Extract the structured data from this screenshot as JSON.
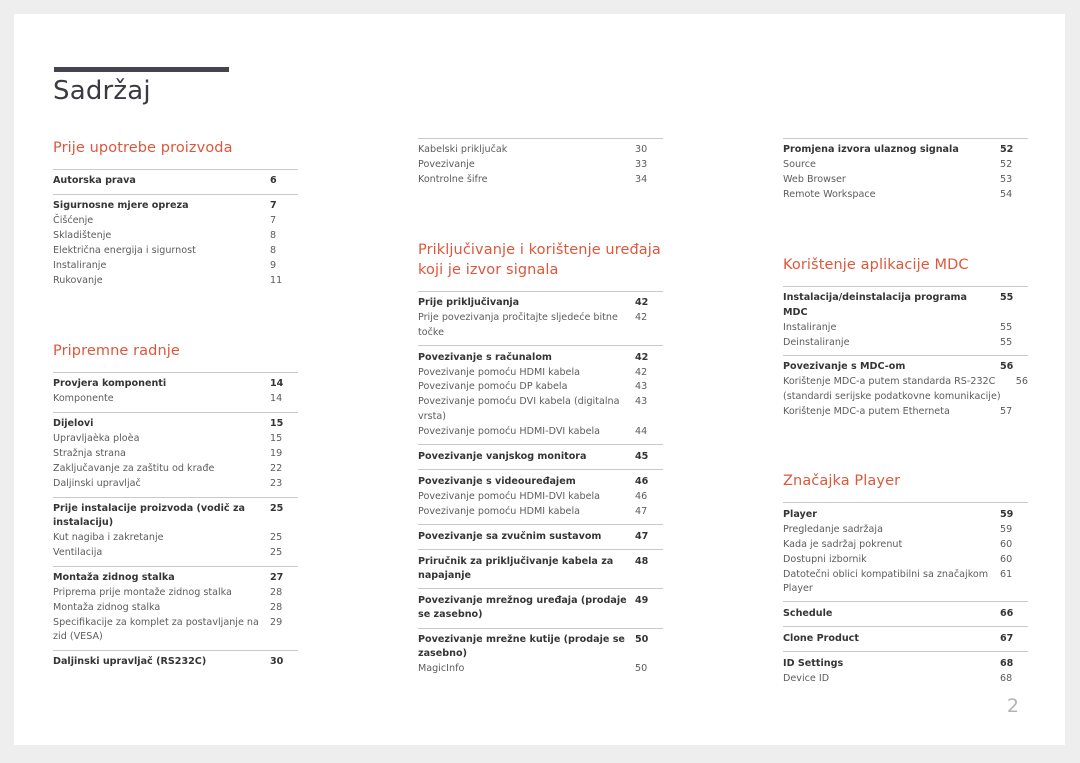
{
  "document": {
    "title": "Sadržaj",
    "folio": "2",
    "accent_color": "#dd573c",
    "rule_color": "#45434e"
  },
  "columns": [
    {
      "id": "column-1",
      "sections": [
        {
          "heading": "Prije upotrebe proizvoda",
          "groups": [
            {
              "entries": [
                {
                  "label": "Autorska prava",
                  "page": "6",
                  "bold": true
                }
              ]
            },
            {
              "entries": [
                {
                  "label": "Sigurnosne mjere opreza",
                  "page": "7",
                  "bold": true
                },
                {
                  "label": "Čišćenje",
                  "page": "7",
                  "bold": false
                },
                {
                  "label": "Skladištenje",
                  "page": "8",
                  "bold": false
                },
                {
                  "label": "Električna energija i sigurnost",
                  "page": "8",
                  "bold": false
                },
                {
                  "label": "Instaliranje",
                  "page": "9",
                  "bold": false
                },
                {
                  "label": "Rukovanje",
                  "page": "11",
                  "bold": false
                }
              ]
            }
          ]
        },
        {
          "heading": "Pripremne radnje",
          "groups": [
            {
              "entries": [
                {
                  "label": "Provjera komponenti",
                  "page": "14",
                  "bold": true
                },
                {
                  "label": "Komponente",
                  "page": "14",
                  "bold": false
                }
              ]
            },
            {
              "entries": [
                {
                  "label": "Dijelovi",
                  "page": "15",
                  "bold": true
                },
                {
                  "label": "Upravljaèka ploèa",
                  "page": "15",
                  "bold": false
                },
                {
                  "label": "Stražnja strana",
                  "page": "19",
                  "bold": false
                },
                {
                  "label": "Zaključavanje za zaštitu od krađe",
                  "page": "22",
                  "bold": false
                },
                {
                  "label": "Daljinski upravljač",
                  "page": "23",
                  "bold": false
                }
              ]
            },
            {
              "entries": [
                {
                  "label": "Prije instalacije proizvoda (vodič za instalaciju)",
                  "page": "25",
                  "bold": true
                },
                {
                  "label": "Kut nagiba i zakretanje",
                  "page": "25",
                  "bold": false
                },
                {
                  "label": "Ventilacija",
                  "page": "25",
                  "bold": false
                }
              ]
            },
            {
              "entries": [
                {
                  "label": "Montaža zidnog stalka",
                  "page": "27",
                  "bold": true
                },
                {
                  "label": "Priprema prije montaže zidnog stalka",
                  "page": "28",
                  "bold": false
                },
                {
                  "label": "Montaža zidnog stalka",
                  "page": "28",
                  "bold": false
                },
                {
                  "label": "Specifikacije za komplet za postavljanje na zid (VESA)",
                  "page": "29",
                  "bold": false
                }
              ]
            },
            {
              "entries": [
                {
                  "label": "Daljinski upravljač (RS232C)",
                  "page": "30",
                  "bold": true
                }
              ]
            }
          ]
        }
      ]
    },
    {
      "id": "column-2",
      "sections": [
        {
          "heading": null,
          "groups": [
            {
              "entries": [
                {
                  "label": "Kabelski priključak",
                  "page": "30",
                  "bold": false
                },
                {
                  "label": "Povezivanje",
                  "page": "33",
                  "bold": false
                },
                {
                  "label": "Kontrolne šifre",
                  "page": "34",
                  "bold": false
                }
              ]
            }
          ]
        },
        {
          "heading": "Priključivanje i korištenje uređaja koji je izvor signala",
          "groups": [
            {
              "entries": [
                {
                  "label": "Prije priključivanja",
                  "page": "42",
                  "bold": true
                },
                {
                  "label": "Prije povezivanja pročitajte sljedeće bitne točke",
                  "page": "42",
                  "bold": false
                }
              ]
            },
            {
              "entries": [
                {
                  "label": "Povezivanje s računalom",
                  "page": "42",
                  "bold": true
                },
                {
                  "label": "Povezivanje pomoću HDMI kabela",
                  "page": "42",
                  "bold": false
                },
                {
                  "label": "Povezivanje pomoću DP kabela",
                  "page": "43",
                  "bold": false
                },
                {
                  "label": "Povezivanje pomoću DVI kabela (digitalna vrsta)",
                  "page": "43",
                  "bold": false
                },
                {
                  "label": "Povezivanje pomoću HDMI-DVI kabela",
                  "page": "44",
                  "bold": false
                }
              ]
            },
            {
              "entries": [
                {
                  "label": "Povezivanje vanjskog monitora",
                  "page": "45",
                  "bold": true
                }
              ]
            },
            {
              "entries": [
                {
                  "label": "Povezivanje s videouređajem",
                  "page": "46",
                  "bold": true
                },
                {
                  "label": "Povezivanje pomoću HDMI-DVI kabela",
                  "page": "46",
                  "bold": false
                },
                {
                  "label": "Povezivanje pomoću HDMI kabela",
                  "page": "47",
                  "bold": false
                }
              ]
            },
            {
              "entries": [
                {
                  "label": "Povezivanje sa zvučnim sustavom",
                  "page": "47",
                  "bold": true
                }
              ]
            },
            {
              "entries": [
                {
                  "label": "Priručnik za priključivanje kabela za napajanje",
                  "page": "48",
                  "bold": true
                }
              ]
            },
            {
              "entries": [
                {
                  "label": "Povezivanje mrežnog uređaja (prodaje se zasebno)",
                  "page": "49",
                  "bold": true
                }
              ]
            },
            {
              "entries": [
                {
                  "label": "Povezivanje mrežne kutije (prodaje se zasebno)",
                  "page": "50",
                  "bold": true
                },
                {
                  "label": "MagicInfo",
                  "page": "50",
                  "bold": false
                }
              ]
            }
          ]
        }
      ]
    },
    {
      "id": "column-3",
      "sections": [
        {
          "heading": null,
          "groups": [
            {
              "entries": [
                {
                  "label": "Promjena izvora ulaznog signala",
                  "page": "52",
                  "bold": true
                },
                {
                  "label": "Source",
                  "page": "52",
                  "bold": false
                },
                {
                  "label": "Web Browser",
                  "page": "53",
                  "bold": false
                },
                {
                  "label": "Remote Workspace",
                  "page": "54",
                  "bold": false
                }
              ]
            }
          ]
        },
        {
          "heading": "Korištenje aplikacije MDC",
          "groups": [
            {
              "entries": [
                {
                  "label": "Instalacija/deinstalacija programa MDC",
                  "page": "55",
                  "bold": true
                },
                {
                  "label": "Instaliranje",
                  "page": "55",
                  "bold": false
                },
                {
                  "label": "Deinstaliranje",
                  "page": "55",
                  "bold": false
                }
              ]
            },
            {
              "entries": [
                {
                  "label": "Povezivanje s MDC-om",
                  "page": "56",
                  "bold": true
                },
                {
                  "label": "Korištenje MDC-a putem standarda RS-232C (standardi serijske podatkovne komunikacije)",
                  "page": "56",
                  "bold": false,
                  "tight": true
                },
                {
                  "label": "Korištenje MDC-a putem Etherneta",
                  "page": "57",
                  "bold": false
                }
              ]
            }
          ]
        },
        {
          "heading": "Značajka Player",
          "groups": [
            {
              "entries": [
                {
                  "label": "Player",
                  "page": "59",
                  "bold": true
                },
                {
                  "label": "Pregledanje sadržaja",
                  "page": "59",
                  "bold": false
                },
                {
                  "label": "Kada je sadržaj pokrenut",
                  "page": "60",
                  "bold": false
                },
                {
                  "label": "Dostupni izbornik",
                  "page": "60",
                  "bold": false
                },
                {
                  "label": "Datotečni oblici kompatibilni sa značajkom Player",
                  "page": "61",
                  "bold": false
                }
              ]
            },
            {
              "entries": [
                {
                  "label": "Schedule",
                  "page": "66",
                  "bold": true
                }
              ]
            },
            {
              "entries": [
                {
                  "label": "Clone Product",
                  "page": "67",
                  "bold": true
                }
              ]
            },
            {
              "entries": [
                {
                  "label": "ID Settings",
                  "page": "68",
                  "bold": true
                },
                {
                  "label": "Device ID",
                  "page": "68",
                  "bold": false
                }
              ]
            }
          ]
        }
      ]
    }
  ]
}
